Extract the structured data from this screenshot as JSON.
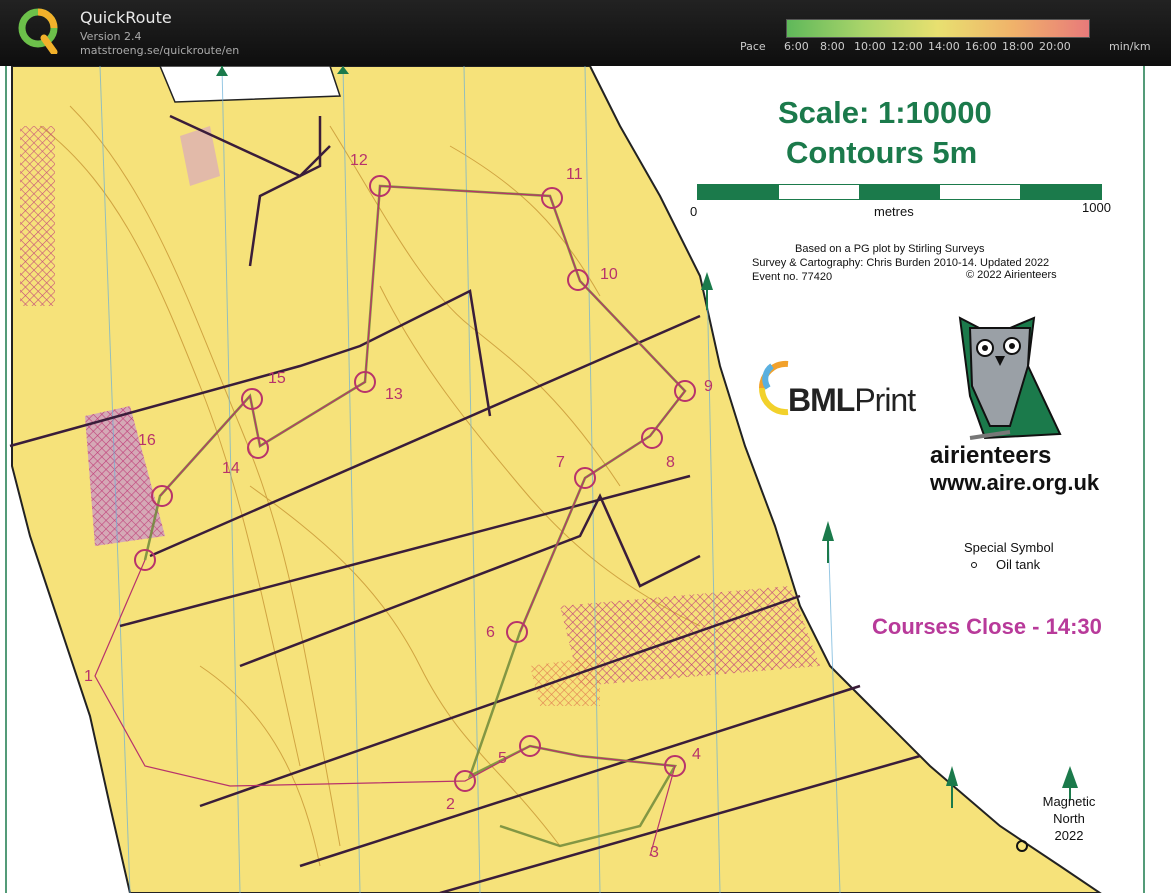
{
  "app": {
    "title": "QuickRoute",
    "version": "Version 2.4",
    "url": "matstroeng.se/quickroute/en"
  },
  "pace": {
    "label": "Pace",
    "unit": "min/km",
    "ticks": [
      "6:00",
      "8:00",
      "10:00",
      "12:00",
      "14:00",
      "16:00",
      "18:00",
      "20:00"
    ],
    "gradient_colors": [
      "#5fb85a",
      "#a9d46a",
      "#e8e070",
      "#f0b26a",
      "#e87a7a"
    ]
  },
  "map": {
    "scale_text": "Scale: 1:10000",
    "contours_text": "Contours 5m",
    "scalebar_start": "0",
    "scalebar_unit": "metres",
    "scalebar_end": "1000",
    "credit_1": "Based on a PG plot by Stirling Surveys",
    "credit_2": "Survey & Cartography: Chris Burden 2010-14.  Updated 2022",
    "credit_3": "Event no.  77420",
    "credit_4": "© 2022 Airienteers",
    "sponsor_a": "BML",
    "sponsor_b": "Print",
    "club_name": "airienteers",
    "club_web": "www.aire.org.uk",
    "special_symbol": "Special Symbol",
    "oil_tank": "Oil tank",
    "courses_close": "Courses Close - 14:30",
    "north_line1": "Magnetic",
    "north_line2": "North",
    "north_line3": "2022",
    "controls": [
      "1",
      "2",
      "3",
      "4",
      "5",
      "6",
      "7",
      "8",
      "9",
      "10",
      "11",
      "12",
      "13",
      "14",
      "15",
      "16"
    ],
    "colors": {
      "terrain": "#f6e27a",
      "course": "#b8336b",
      "route": "#6f8a3a",
      "accent_green": "#1b7a4b",
      "close_text": "#b83a9a"
    }
  }
}
